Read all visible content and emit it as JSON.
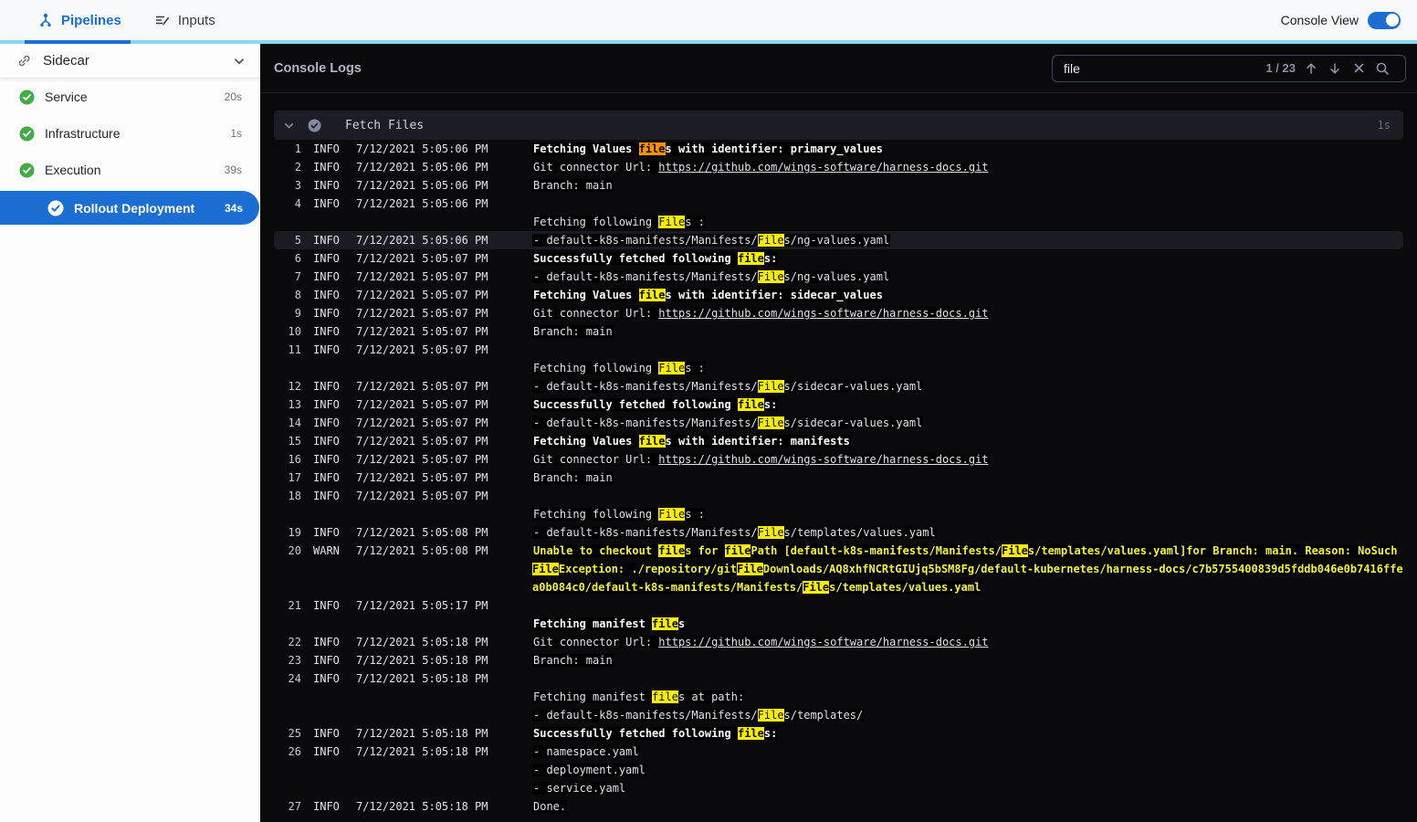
{
  "topbar": {
    "tabs": [
      {
        "label": "Pipelines",
        "icon": "pipeline-icon",
        "active": true
      },
      {
        "label": "Inputs",
        "icon": "inputs-icon",
        "active": false
      }
    ],
    "console_view_label": "Console View",
    "console_view_on": true
  },
  "sidebar": {
    "stage": {
      "label": "Sidecar",
      "icon": "link-icon"
    },
    "items": [
      {
        "label": "Service",
        "duration": "20s",
        "status": "success"
      },
      {
        "label": "Infrastructure",
        "duration": "1s",
        "status": "success"
      },
      {
        "label": "Execution",
        "duration": "39s",
        "status": "success"
      }
    ],
    "selected_step": {
      "label": "Rollout Deployment",
      "duration": "34s",
      "status": "success"
    }
  },
  "console": {
    "title": "Console Logs",
    "search": {
      "query": "file",
      "counter": "1 / 23",
      "current_index": 1,
      "total_matches": 23
    },
    "section": {
      "title": "Fetch Files",
      "duration": "1s"
    },
    "logs": [
      {
        "num": 1,
        "level": "INFO",
        "time": "7/12/2021 5:05:06 PM",
        "style": "bold",
        "lines": [
          "Fetching Values files with identifier: primary_values"
        ]
      },
      {
        "num": 2,
        "level": "INFO",
        "time": "7/12/2021 5:05:06 PM",
        "lines": [
          "Git connector Url: https://github.com/wings-software/harness-docs.git"
        ]
      },
      {
        "num": 3,
        "level": "INFO",
        "time": "7/12/2021 5:05:06 PM",
        "lines": [
          "Branch: main"
        ]
      },
      {
        "num": 4,
        "level": "INFO",
        "time": "7/12/2021 5:05:06 PM",
        "lines": [
          "",
          "Fetching following Files :"
        ]
      },
      {
        "num": 5,
        "level": "INFO",
        "time": "7/12/2021 5:05:06 PM",
        "selected": true,
        "lines": [
          "- default-k8s-manifests/Manifests/Files/ng-values.yaml"
        ]
      },
      {
        "num": 6,
        "level": "INFO",
        "time": "7/12/2021 5:05:07 PM",
        "style": "bold",
        "lines": [
          "Successfully fetched following files:"
        ]
      },
      {
        "num": 7,
        "level": "INFO",
        "time": "7/12/2021 5:05:07 PM",
        "lines": [
          "- default-k8s-manifests/Manifests/Files/ng-values.yaml"
        ]
      },
      {
        "num": 8,
        "level": "INFO",
        "time": "7/12/2021 5:05:07 PM",
        "style": "bold",
        "lines": [
          "Fetching Values files with identifier: sidecar_values"
        ]
      },
      {
        "num": 9,
        "level": "INFO",
        "time": "7/12/2021 5:05:07 PM",
        "lines": [
          "Git connector Url: https://github.com/wings-software/harness-docs.git"
        ]
      },
      {
        "num": 10,
        "level": "INFO",
        "time": "7/12/2021 5:05:07 PM",
        "lines": [
          "Branch: main"
        ]
      },
      {
        "num": 11,
        "level": "INFO",
        "time": "7/12/2021 5:05:07 PM",
        "lines": [
          "",
          "Fetching following Files :"
        ]
      },
      {
        "num": 12,
        "level": "INFO",
        "time": "7/12/2021 5:05:07 PM",
        "lines": [
          "- default-k8s-manifests/Manifests/Files/sidecar-values.yaml"
        ]
      },
      {
        "num": 13,
        "level": "INFO",
        "time": "7/12/2021 5:05:07 PM",
        "style": "bold",
        "lines": [
          "Successfully fetched following files:"
        ]
      },
      {
        "num": 14,
        "level": "INFO",
        "time": "7/12/2021 5:05:07 PM",
        "lines": [
          "- default-k8s-manifests/Manifests/Files/sidecar-values.yaml"
        ]
      },
      {
        "num": 15,
        "level": "INFO",
        "time": "7/12/2021 5:05:07 PM",
        "style": "bold",
        "lines": [
          "Fetching Values files with identifier: manifests"
        ]
      },
      {
        "num": 16,
        "level": "INFO",
        "time": "7/12/2021 5:05:07 PM",
        "lines": [
          "Git connector Url: https://github.com/wings-software/harness-docs.git"
        ]
      },
      {
        "num": 17,
        "level": "INFO",
        "time": "7/12/2021 5:05:07 PM",
        "lines": [
          "Branch: main"
        ]
      },
      {
        "num": 18,
        "level": "INFO",
        "time": "7/12/2021 5:05:07 PM",
        "lines": [
          "",
          "Fetching following Files :"
        ]
      },
      {
        "num": 19,
        "level": "INFO",
        "time": "7/12/2021 5:05:08 PM",
        "lines": [
          "- default-k8s-manifests/Manifests/Files/templates/values.yaml"
        ]
      },
      {
        "num": 20,
        "level": "WARN",
        "time": "7/12/2021 5:05:08 PM",
        "style": "warn",
        "lines": [
          "Unable to checkout files for filePath [default-k8s-manifests/Manifests/Files/templates/values.yaml]for Branch: main. Reason: NoSuchFileException: ./repository/gitFileDownloads/AQ8xhfNCRtGIUjq5bSM8Fg/default-kubernetes/harness-docs/c7b5755400839d5fddb046e0b7416ffea0b084c0/default-k8s-manifests/Manifests/Files/templates/values.yaml"
        ]
      },
      {
        "num": 21,
        "level": "INFO",
        "time": "7/12/2021 5:05:17 PM",
        "style": "bold",
        "lines": [
          "",
          "Fetching manifest files"
        ]
      },
      {
        "num": 22,
        "level": "INFO",
        "time": "7/12/2021 5:05:18 PM",
        "lines": [
          "Git connector Url: https://github.com/wings-software/harness-docs.git"
        ]
      },
      {
        "num": 23,
        "level": "INFO",
        "time": "7/12/2021 5:05:18 PM",
        "lines": [
          "Branch: main"
        ]
      },
      {
        "num": 24,
        "level": "INFO",
        "time": "7/12/2021 5:05:18 PM",
        "lines": [
          "",
          "Fetching manifest files at path:",
          "- default-k8s-manifests/Manifests/Files/templates/"
        ]
      },
      {
        "num": 25,
        "level": "INFO",
        "time": "7/12/2021 5:05:18 PM",
        "style": "bold",
        "lines": [
          "Successfully fetched following files:"
        ]
      },
      {
        "num": 26,
        "level": "INFO",
        "time": "7/12/2021 5:05:18 PM",
        "lines": [
          "- namespace.yaml",
          "- deployment.yaml",
          "- service.yaml"
        ]
      },
      {
        "num": 27,
        "level": "INFO",
        "time": "7/12/2021 5:05:18 PM",
        "lines": [
          "Done."
        ]
      }
    ]
  },
  "colors": {
    "accent_blue": "#1b6fd3",
    "tab_strip_blue": "#8bd7f3",
    "success_green": "#42ab45",
    "highlight_yellow": "#fbee02",
    "current_match_orange": "#ff9102",
    "warn_text_yellow": "#f6f32a",
    "console_bg": "#0a0a0d"
  }
}
